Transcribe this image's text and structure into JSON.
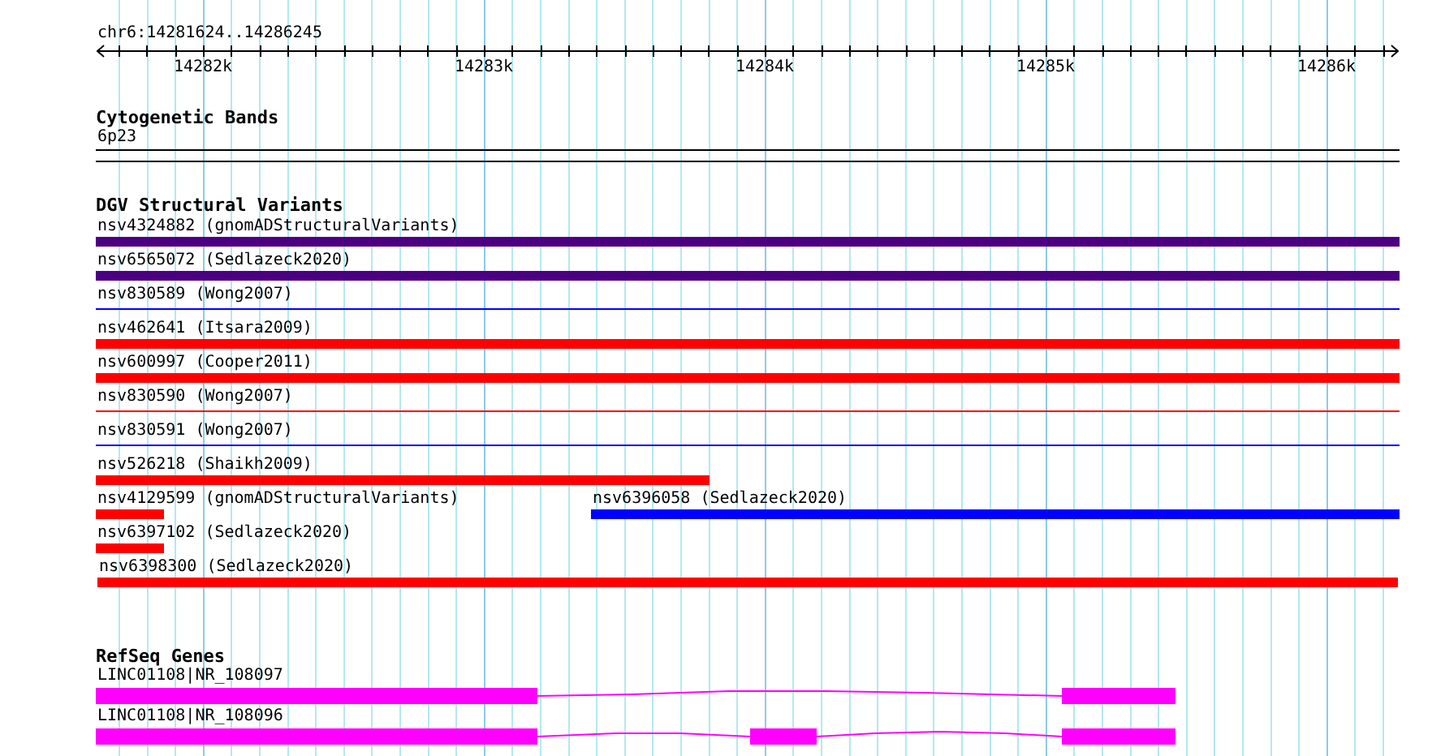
{
  "location": "chr6:14281624..14286245",
  "ruler": {
    "ticks": [
      "14282k",
      "14283k",
      "14284k",
      "14285k",
      "14286k"
    ]
  },
  "tracks": [
    {
      "kind": "cytoband",
      "title": "Cytogenetic Bands",
      "features": [
        {
          "label": "6p23"
        }
      ]
    },
    {
      "kind": "variants",
      "title": "DGV Structural Variants",
      "rows": [
        {
          "features": [
            {
              "label": "nsv4324882 (gnomADStructuralVariants)",
              "color": "#4b0082",
              "kind": "bar"
            }
          ]
        },
        {
          "features": [
            {
              "label": "nsv6565072 (Sedlazeck2020)",
              "color": "#4b0082",
              "kind": "bar"
            }
          ]
        },
        {
          "features": [
            {
              "label": "nsv830589 (Wong2007)",
              "color": "#0000ff",
              "kind": "line"
            }
          ]
        },
        {
          "features": [
            {
              "label": "nsv462641 (Itsara2009)",
              "color": "#ff0000",
              "kind": "bar"
            }
          ]
        },
        {
          "features": [
            {
              "label": "nsv600997 (Cooper2011)",
              "color": "#ff0000",
              "kind": "bar"
            }
          ]
        },
        {
          "features": [
            {
              "label": "nsv830590 (Wong2007)",
              "color": "#ff0000",
              "kind": "line"
            }
          ]
        },
        {
          "features": [
            {
              "label": "nsv830591 (Wong2007)",
              "color": "#0000ff",
              "kind": "line"
            }
          ]
        },
        {
          "features": [
            {
              "label": "nsv526218 (Shaikh2009)",
              "color": "#ff0000",
              "kind": "bar"
            }
          ]
        },
        {
          "features": [
            {
              "label": "nsv4129599 (gnomADStructuralVariants)",
              "color": "#ff0000",
              "kind": "bar"
            },
            {
              "label": "nsv6396058 (Sedlazeck2020)",
              "color": "#0000ff",
              "kind": "bar"
            }
          ]
        },
        {
          "features": [
            {
              "label": "nsv6397102 (Sedlazeck2020)",
              "color": "#ff0000",
              "kind": "bar"
            }
          ]
        },
        {
          "features": [
            {
              "label": "nsv6398300 (Sedlazeck2020)",
              "color": "#ff0000",
              "kind": "bar"
            }
          ]
        }
      ]
    },
    {
      "kind": "genes",
      "title": "RefSeq Genes",
      "features": [
        {
          "label": "LINC01108|NR_108097"
        },
        {
          "label": "LINC01108|NR_108096"
        }
      ]
    }
  ]
}
